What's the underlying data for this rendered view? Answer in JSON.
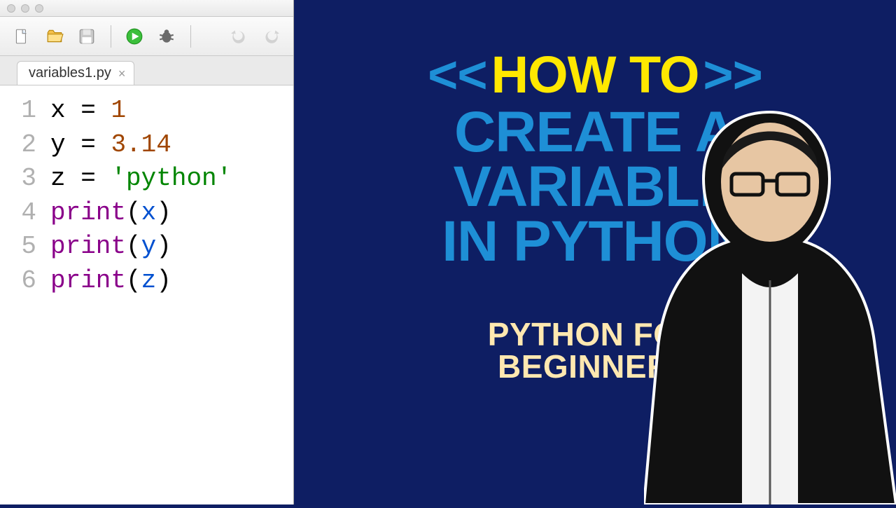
{
  "ide": {
    "tab": {
      "filename": "variables1.py",
      "close_label": "×"
    },
    "toolbar_icons": {
      "new_file": "new-file-icon",
      "open": "open-folder-icon",
      "save": "save-icon",
      "run": "run-icon",
      "debug": "debug-icon",
      "undo": "undo-icon",
      "redo": "redo-icon"
    },
    "lines": [
      {
        "n": "1",
        "tokens": [
          {
            "t": "x ",
            "c": "name"
          },
          {
            "t": "= ",
            "c": "op"
          },
          {
            "t": "1",
            "c": "num"
          }
        ]
      },
      {
        "n": "2",
        "tokens": [
          {
            "t": "y ",
            "c": "name"
          },
          {
            "t": "= ",
            "c": "op"
          },
          {
            "t": "3.14",
            "c": "num"
          }
        ]
      },
      {
        "n": "3",
        "tokens": [
          {
            "t": "z ",
            "c": "name"
          },
          {
            "t": "= ",
            "c": "op"
          },
          {
            "t": "'python'",
            "c": "str"
          }
        ]
      },
      {
        "n": "4",
        "tokens": [
          {
            "t": "print",
            "c": "func"
          },
          {
            "t": "(",
            "c": "paren"
          },
          {
            "t": "x",
            "c": "arg"
          },
          {
            "t": ")",
            "c": "paren"
          }
        ]
      },
      {
        "n": "5",
        "tokens": [
          {
            "t": "print",
            "c": "func"
          },
          {
            "t": "(",
            "c": "paren"
          },
          {
            "t": "y",
            "c": "arg"
          },
          {
            "t": ")",
            "c": "paren"
          }
        ]
      },
      {
        "n": "6",
        "tokens": [
          {
            "t": "print",
            "c": "func"
          },
          {
            "t": "(",
            "c": "paren"
          },
          {
            "t": "z",
            "c": "arg"
          },
          {
            "t": ")",
            "c": "paren"
          }
        ]
      }
    ]
  },
  "promo": {
    "angle_open": "<<",
    "angle_close": ">>",
    "headline": "HOW TO",
    "subhead_lines": [
      "CREATE A",
      "VARIABLE",
      "IN PYTHON"
    ],
    "tagline_lines": [
      "PYTHON FOR",
      "BEGINNERS"
    ]
  },
  "colors": {
    "promo_bg": "#0e1e63",
    "yellow": "#ffe800",
    "blue": "#1e8fd6",
    "cream": "#ffe8b0"
  }
}
